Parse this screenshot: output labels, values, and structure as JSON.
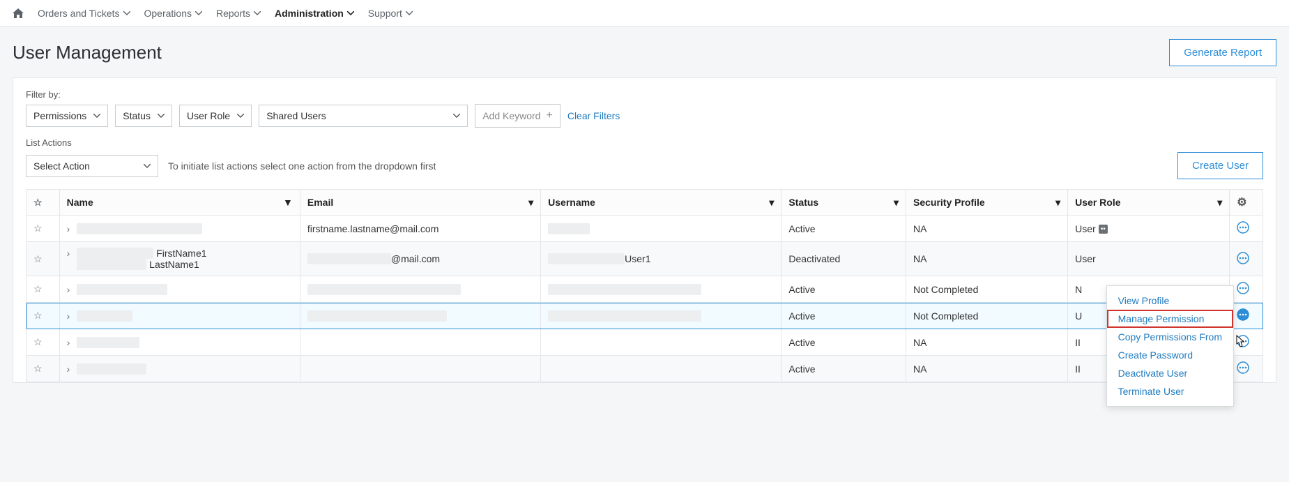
{
  "nav": {
    "items": [
      {
        "label": "Orders and Tickets"
      },
      {
        "label": "Operations"
      },
      {
        "label": "Reports"
      },
      {
        "label": "Administration",
        "active": true
      },
      {
        "label": "Support"
      }
    ]
  },
  "page": {
    "title": "User Management",
    "generate_report": "Generate Report"
  },
  "filters": {
    "label": "Filter by:",
    "permissions": "Permissions",
    "status": "Status",
    "user_role": "User Role",
    "shared_users": "Shared Users",
    "add_keyword": "Add Keyword",
    "clear": "Clear Filters"
  },
  "list_actions": {
    "label": "List Actions",
    "select": "Select Action",
    "hint": "To initiate list actions select one action from the dropdown first",
    "create_user": "Create User"
  },
  "table": {
    "headers": {
      "name": "Name",
      "email": "Email",
      "username": "Username",
      "status": "Status",
      "security": "Security Profile",
      "role": "User Role"
    },
    "rows": [
      {
        "name_redacted": true,
        "email": "firstname.lastname@mail.com",
        "username_redacted": true,
        "status": "Active",
        "security": "NA",
        "role": "User",
        "role_badge": true
      },
      {
        "name_parts": [
          "FirstName1",
          "LastName1"
        ],
        "email_suffix": "@mail.com",
        "username_suffix": "User1",
        "status": "Deactivated",
        "security": "NA",
        "role": "User",
        "alt": true
      },
      {
        "name_redacted": true,
        "email_redacted": true,
        "username_redacted": true,
        "status": "Active",
        "security": "Not Completed",
        "role_prefix": "N"
      },
      {
        "name_redacted": true,
        "email_redacted": true,
        "username_redacted": true,
        "status": "Active",
        "security": "Not Completed",
        "role_prefix": "U",
        "highlight": true
      },
      {
        "name_redacted": true,
        "status": "Active",
        "security": "NA",
        "role_prefix": "II"
      },
      {
        "name_redacted": true,
        "status": "Active",
        "security": "NA",
        "role_prefix": "II",
        "alt": true
      }
    ]
  },
  "context_menu": {
    "items": [
      "View Profile",
      "Manage Permission",
      "Copy Permissions From",
      "Create Password",
      "Deactivate User",
      "Terminate User"
    ],
    "highlighted_index": 1
  }
}
